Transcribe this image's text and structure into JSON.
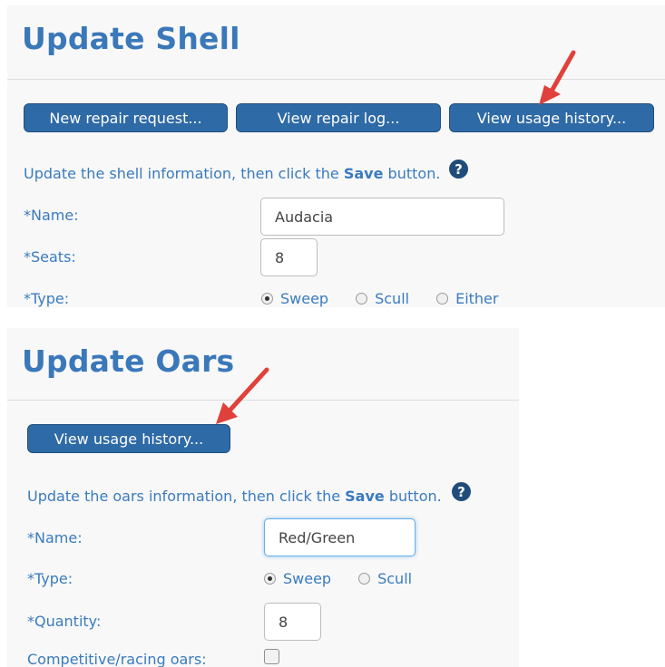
{
  "shell": {
    "title": "Update Shell",
    "buttons": {
      "new_repair": "New repair request...",
      "view_repair_log": "View repair log...",
      "view_usage": "View usage history..."
    },
    "instruction": {
      "before": "Update the shell information, then click the ",
      "emphasis": "Save",
      "after": " button."
    },
    "help_icon": "?",
    "fields": {
      "name_label": "*Name:",
      "name_value": "Audacia",
      "seats_label": "*Seats:",
      "seats_value": "8",
      "type_label": "*Type:",
      "type_options": [
        "Sweep",
        "Scull",
        "Either"
      ],
      "type_selected": "Sweep"
    }
  },
  "oars": {
    "title": "Update Oars",
    "buttons": {
      "view_usage": "View usage history..."
    },
    "instruction": {
      "before": "Update the oars information, then click the ",
      "emphasis": "Save",
      "after": " button."
    },
    "help_icon": "?",
    "fields": {
      "name_label": "*Name:",
      "name_value": "Red/Green",
      "type_label": "*Type:",
      "type_options": [
        "Sweep",
        "Scull"
      ],
      "type_selected": "Sweep",
      "quantity_label": "*Quantity:",
      "quantity_value": "8",
      "competitive_label": "Competitive/racing oars:",
      "competitive_checked": false
    }
  },
  "colors": {
    "accent_text": "#3a7bbf",
    "button_bg": "#2e6aa6",
    "arrow": "#e0413b"
  },
  "icons": [
    "help-icon",
    "red-arrow-icon"
  ]
}
